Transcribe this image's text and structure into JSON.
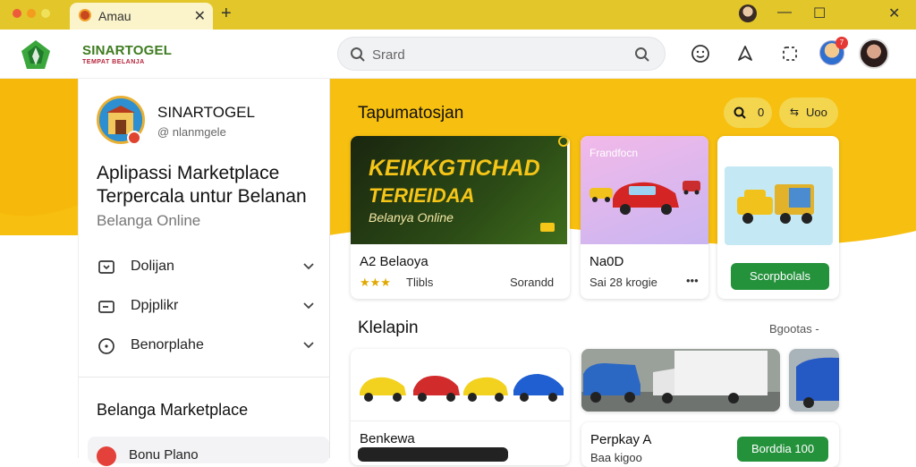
{
  "window": {
    "tab_title": "Amau",
    "tab_close": "✕",
    "new_tab": "+",
    "controls": {
      "minimize": "—",
      "maximize": "☐",
      "close": "✕"
    }
  },
  "header": {
    "brand": "SINARTOGEL",
    "brand_sub": "TEMPAT BELANJA",
    "search_placeholder": "Srard",
    "notification_count": "7"
  },
  "sidebar": {
    "store_name": "SINARTOGEL",
    "store_handle": "@ nlanmgele",
    "tagline": "Aplipassi Marketplace Terpercala untur Belanan",
    "subtitle": "Belanga Online",
    "menu": [
      {
        "label": "Dolijan",
        "icon": "flag-icon"
      },
      {
        "label": "Dpjplikr",
        "icon": "card-icon"
      },
      {
        "label": "Benorplahe",
        "icon": "info-icon"
      }
    ],
    "section_title": "Belanga Marketplace",
    "bottom_item": "Bonu Plano"
  },
  "main": {
    "title": "Tapumatosjan",
    "filter_label": "0",
    "sort_label": "Uoo",
    "promo_line1": "KEIKKGTICHAD",
    "promo_line2": "TERIEIDAA",
    "promo_tag": "Belanya Online",
    "cards": [
      {
        "title": "A2 Belaoya",
        "rating_text": "Tlibls",
        "meta_right": "Sorandd"
      },
      {
        "label": "Frandfocn",
        "title": "Na0D",
        "meta": "Sai 28 krogie",
        "more": "•••"
      },
      {
        "button": "Scorpbolals"
      }
    ],
    "section_title": "Klelapin",
    "section_link": "Bgootas -",
    "bottom_cards": [
      {
        "title": "Benkewa"
      },
      {
        "title": "Perpkay A",
        "meta": "Baa kigoo",
        "button": "Borddia 100"
      }
    ]
  },
  "colors": {
    "accent_yellow": "#f5c518",
    "banner_yellow": "#f7bf0f",
    "green": "#24913b",
    "promo_dark": "#1d2f0f"
  }
}
